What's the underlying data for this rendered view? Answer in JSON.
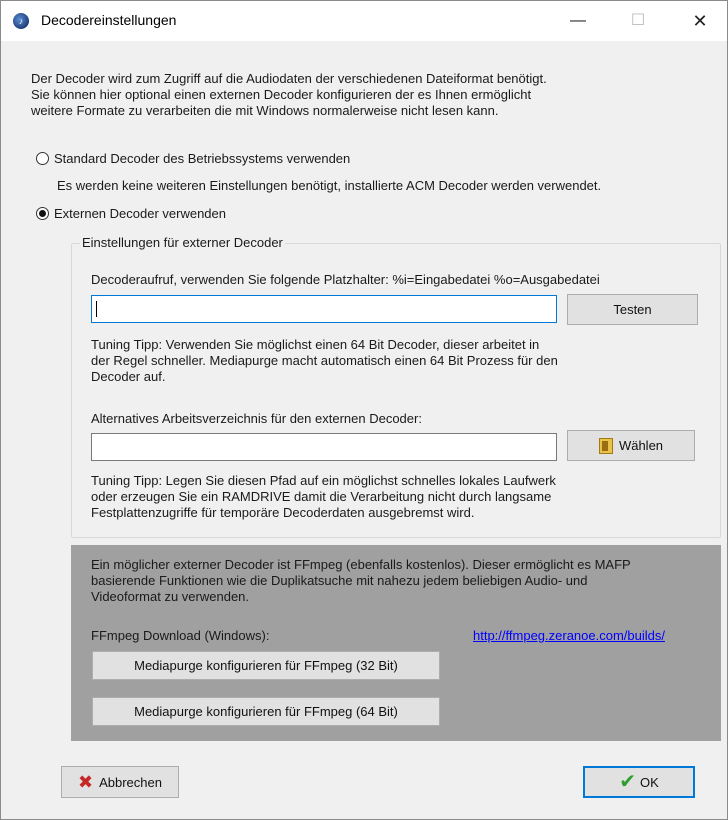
{
  "window": {
    "title": "Decodereinstellungen"
  },
  "intro": {
    "line1": "Der Decoder wird zum Zugriff auf die Audiodaten der verschiedenen Dateiformat benötigt.",
    "line2": "Sie können hier optional einen externen Decoder konfigurieren der es Ihnen ermöglicht",
    "line3": "weitere Formate zu verarbeiten die mit Windows normalerweise nicht lesen kann."
  },
  "options": {
    "standard_label": "Standard Decoder des Betriebssystems verwenden",
    "standard_note": "Es werden keine weiteren Einstellungen benötigt, installierte ACM Decoder werden verwendet.",
    "external_label": "Externen Decoder verwenden",
    "selected": "external"
  },
  "group": {
    "title": "Einstellungen für externer Decoder",
    "call_label": "Decoderaufruf, verwenden Sie folgende Platzhalter: %i=Eingabedatei %o=Ausgabedatei",
    "call_value": "",
    "test_button": "Testen",
    "tip1_l1": "Tuning Tipp: Verwenden Sie möglichst einen 64 Bit Decoder, dieser arbeitet in",
    "tip1_l2": "der Regel schneller. Mediapurge macht automatisch einen 64 Bit Prozess für den",
    "tip1_l3": "Decoder auf.",
    "workdir_label": "Alternatives Arbeitsverzeichnis für den externen Decoder:",
    "workdir_value": "",
    "choose_button": "Wählen",
    "tip2_l1": "Tuning Tipp: Legen Sie diesen Pfad auf ein möglichst schnelles lokales Laufwerk",
    "tip2_l2": "oder erzeugen Sie ein RAMDRIVE damit die Verarbeitung nicht durch langsame",
    "tip2_l3": "Festplattenzugriffe für temporäre Decoderdaten ausgebremst wird."
  },
  "ffmpeg": {
    "text_l1": "Ein möglicher externer Decoder ist FFmpeg (ebenfalls kostenlos). Dieser ermöglicht es MAFP",
    "text_l2": "basierende Funktionen wie die Duplikatsuche mit nahezu jedem beliebigen Audio- und",
    "text_l3": "Videoformat zu verwenden.",
    "download_label": "FFmpeg Download (Windows):",
    "download_link": "http://ffmpeg.zeranoe.com/builds/",
    "btn32": "Mediapurge konfigurieren für FFmpeg (32 Bit)",
    "btn64": "Mediapurge konfigurieren für FFmpeg (64 Bit)"
  },
  "footer": {
    "cancel": "Abbrechen",
    "ok": "OK"
  },
  "icons": {
    "cancel": "x-icon",
    "ok": "checkmark-icon",
    "choose": "folder-icon",
    "app": "app-icon"
  }
}
